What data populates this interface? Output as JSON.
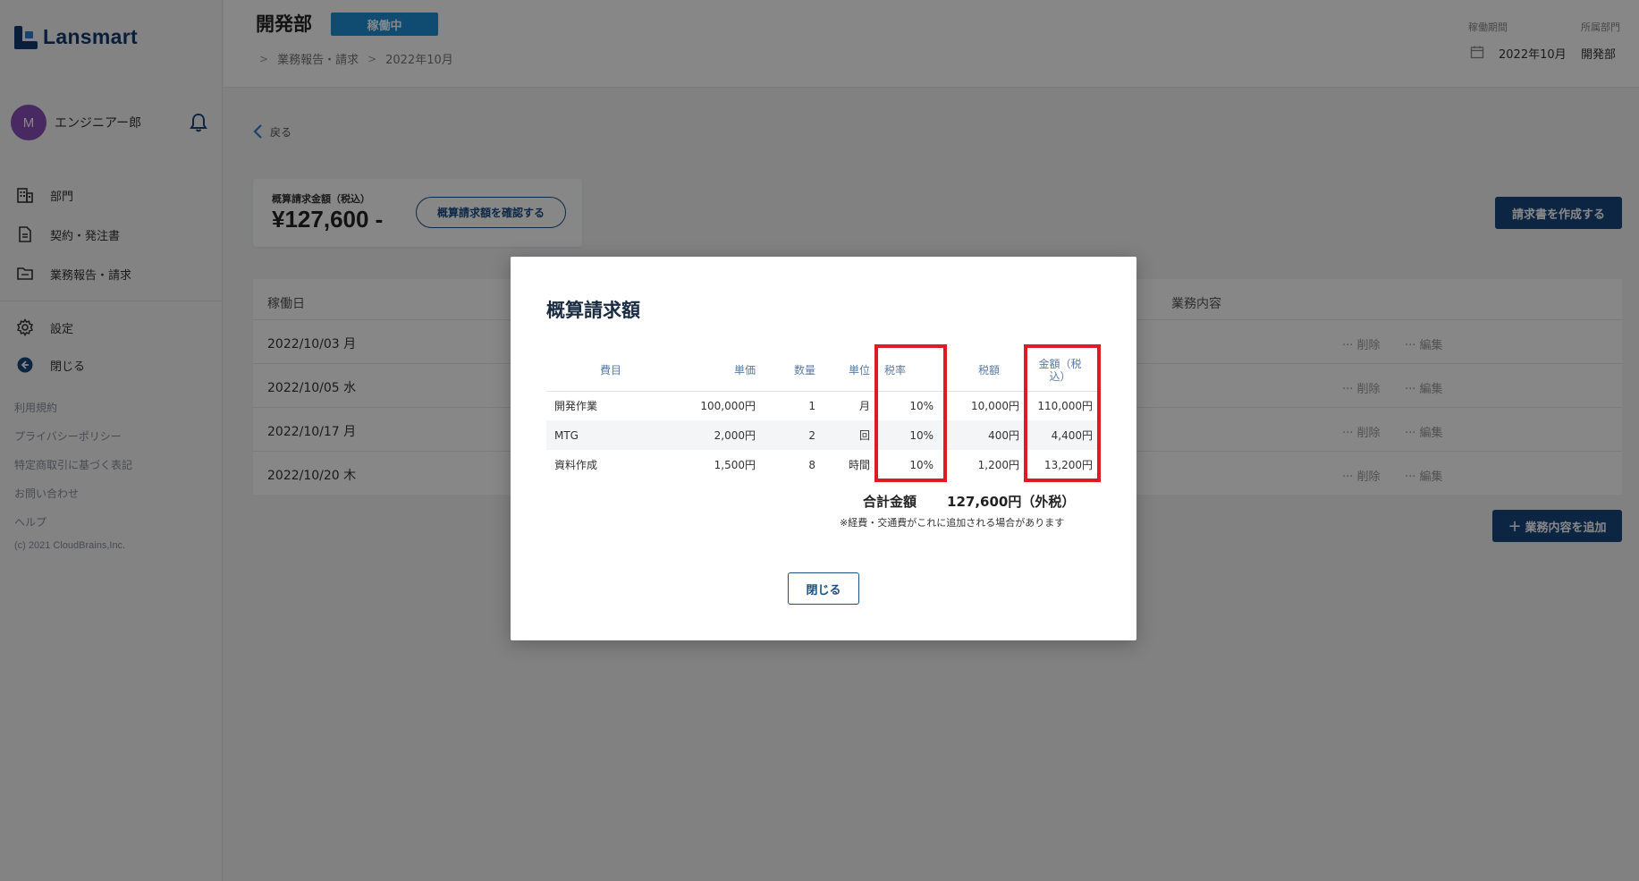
{
  "app": {
    "logo_text": "Lansmart"
  },
  "user": {
    "avatar_initial": "M",
    "name": "エンジニアー郎"
  },
  "sidebar": {
    "nav": [
      {
        "label": "部門",
        "icon": "building-icon"
      },
      {
        "label": "契約・発注書",
        "icon": "document-icon"
      },
      {
        "label": "業務報告・請求",
        "icon": "folder-icon"
      }
    ],
    "settings": [
      {
        "label": "設定",
        "icon": "gear-icon"
      },
      {
        "label": "閉じる",
        "icon": "back-circle-icon"
      }
    ],
    "footer_links": [
      "利用規約",
      "プライバシーポリシー",
      "特定商取引に基づく表記",
      "お問い合わせ",
      "ヘルプ"
    ],
    "copyright": "(c) 2021 CloudBrains,Inc."
  },
  "header": {
    "title": "開発部",
    "status": "稼働中",
    "breadcrumb": [
      "業務報告・請求",
      "2022年10月"
    ],
    "period_label": "稼働期間",
    "period_value": "2022年10月",
    "dept_label": "所属部門",
    "dept_value": "開発部"
  },
  "main": {
    "back_label": "戻る",
    "estimate": {
      "label": "概算請求金額（税込）",
      "amount": "¥127,600 -",
      "confirm_button": "概算請求額を確認する"
    },
    "create_invoice_button": "請求書を作成する",
    "add_work_button": "業務内容を追加",
    "table": {
      "col_date": "稼働日",
      "col_content": "業務内容",
      "rows": [
        {
          "date": "2022/10/03 月"
        },
        {
          "date": "2022/10/05 水"
        },
        {
          "date": "2022/10/17 月"
        },
        {
          "date": "2022/10/20 木"
        }
      ],
      "delete_label": "··· 削除",
      "edit_label": "··· 編集"
    }
  },
  "modal": {
    "title": "概算請求額",
    "columns": [
      "費目",
      "単価",
      "数量",
      "単位",
      "税率",
      "税額",
      "金額（税込）"
    ],
    "rows": [
      {
        "name": "開発作業",
        "price": "100,000円",
        "qty": "1",
        "unit": "月",
        "rate": "10%",
        "tax": "10,000円",
        "amount": "110,000円"
      },
      {
        "name": "MTG",
        "price": "2,000円",
        "qty": "2",
        "unit": "回",
        "rate": "10%",
        "tax": "400円",
        "amount": "4,400円"
      },
      {
        "name": "資料作成",
        "price": "1,500円",
        "qty": "8",
        "unit": "時間",
        "rate": "10%",
        "tax": "1,200円",
        "amount": "13,200円"
      }
    ],
    "total_label": "合計金額",
    "total_value": "127,600円（外税）",
    "note": "※経費・交通費がこれに追加される場合があります",
    "close_button": "閉じる"
  },
  "colors": {
    "brand": "#123a6e",
    "primary_button": "#17467f",
    "status_badge": "#1f8fd8",
    "highlight": "#e01a23",
    "avatar": "#8a4fb8"
  }
}
